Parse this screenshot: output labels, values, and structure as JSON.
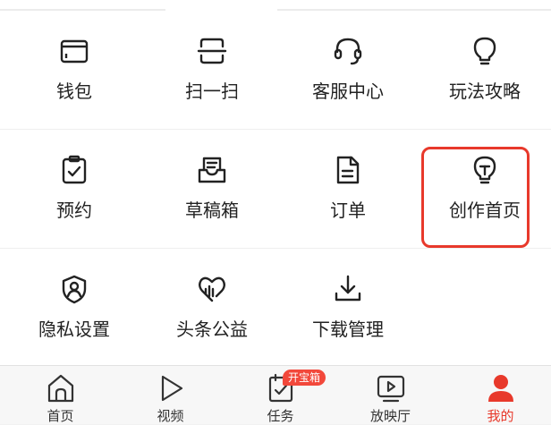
{
  "menu": {
    "items": [
      {
        "label": "钱包",
        "icon": "wallet-icon"
      },
      {
        "label": "扫一扫",
        "icon": "scan-icon"
      },
      {
        "label": "客服中心",
        "icon": "headset-icon"
      },
      {
        "label": "玩法攻略",
        "icon": "lightbulb-icon"
      },
      {
        "label": "预约",
        "icon": "clipboard-check-icon"
      },
      {
        "label": "草稿箱",
        "icon": "drafts-inbox-icon"
      },
      {
        "label": "订单",
        "icon": "order-document-icon"
      },
      {
        "label": "创作首页",
        "icon": "creator-lightbulb-icon"
      },
      {
        "label": "隐私设置",
        "icon": "privacy-shield-icon"
      },
      {
        "label": "头条公益",
        "icon": "charity-heart-icon"
      },
      {
        "label": "下载管理",
        "icon": "download-icon"
      }
    ]
  },
  "tabbar": {
    "tabs": [
      {
        "label": "首页",
        "icon": "home-icon"
      },
      {
        "label": "视频",
        "icon": "play-icon"
      },
      {
        "label": "任务",
        "icon": "task-check-icon"
      },
      {
        "label": "放映厅",
        "icon": "theater-icon"
      },
      {
        "label": "我的",
        "icon": "profile-icon"
      }
    ],
    "badge": "开宝箱",
    "active_color": "#e8392b"
  },
  "highlight_color": "#e8392b"
}
